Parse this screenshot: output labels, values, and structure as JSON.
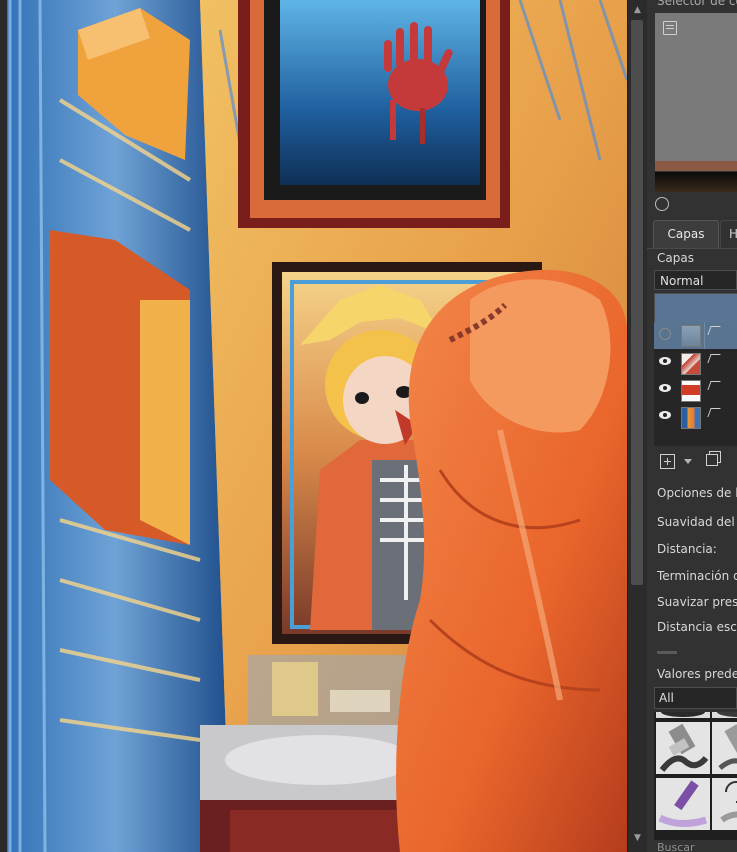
{
  "canvas": {
    "artwork": "digital painting in progress"
  },
  "docker": {
    "color_selector_title": "Selector de colo",
    "tabs": [
      {
        "label": "Capas",
        "active": true
      },
      {
        "label": "H",
        "active": false
      }
    ],
    "layers_title": "Capas",
    "blend_mode": "Normal",
    "layers": [
      {
        "visible": false,
        "selected": true
      },
      {
        "visible": true,
        "selected": false
      },
      {
        "visible": true,
        "selected": false
      },
      {
        "visible": true,
        "selected": false
      }
    ],
    "brush_options": {
      "title": "Opciones de la",
      "smoothness": "Suavidad del pi",
      "distance": "Distancia:",
      "ending": "Terminación de",
      "pressure_smoothing": "Suavizar presió",
      "scale_distance": "Distancia escala"
    },
    "presets": {
      "title": "Valores predefi",
      "filter": "All",
      "search_label": "Buscar"
    }
  },
  "colors": {
    "panel_bg": "#323232",
    "selection": "#587490",
    "accent_orange": "#e96a2c"
  }
}
